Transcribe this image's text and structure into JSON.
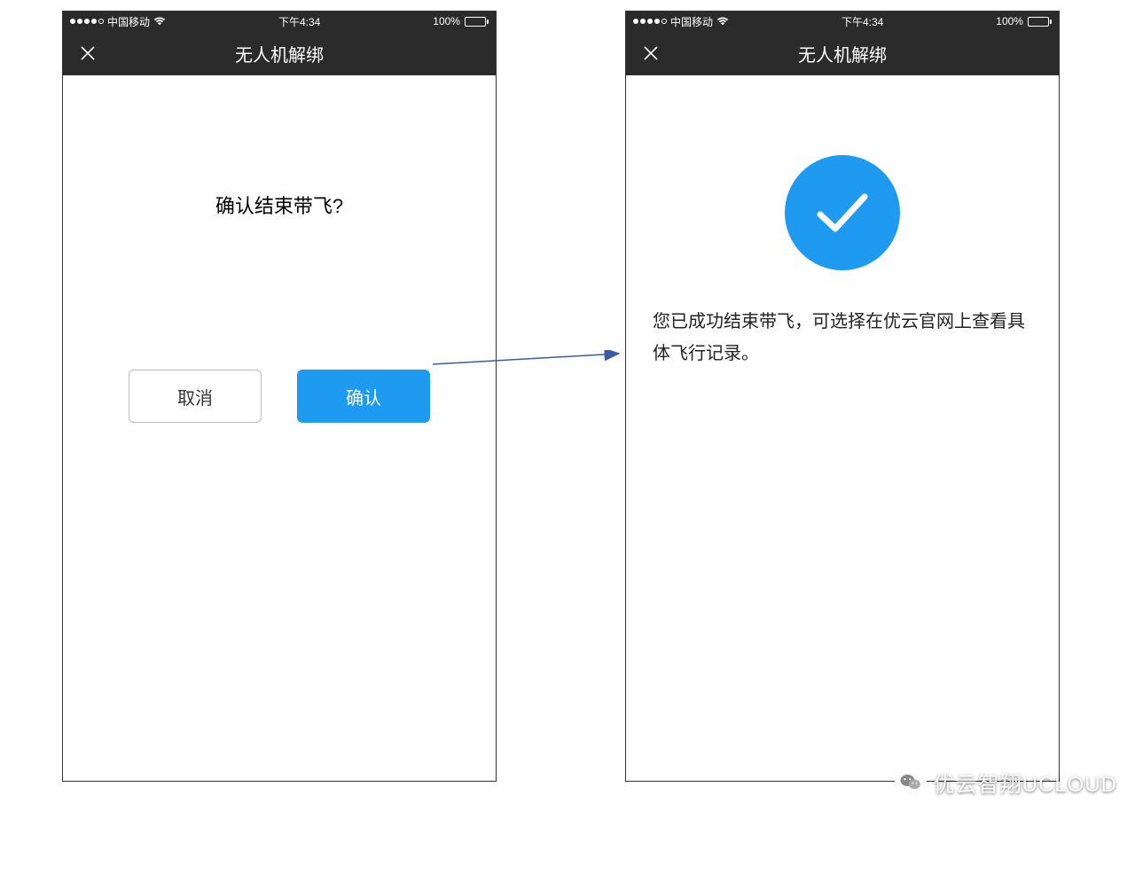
{
  "status": {
    "carrier": "中国移动",
    "time": "下午4:34",
    "battery_pct": "100%"
  },
  "nav": {
    "title": "无人机解绑"
  },
  "screen_left": {
    "prompt": "确认结束带飞?",
    "cancel_label": "取消",
    "confirm_label": "确认"
  },
  "screen_right": {
    "success_message": "您已成功结束带飞，可选择在优云官网上查看具体飞行记录。"
  },
  "watermark": {
    "text": "优云智翔UCLOUD"
  },
  "colors": {
    "accent": "#1e9bf0",
    "navbar": "#2b2b2b"
  }
}
